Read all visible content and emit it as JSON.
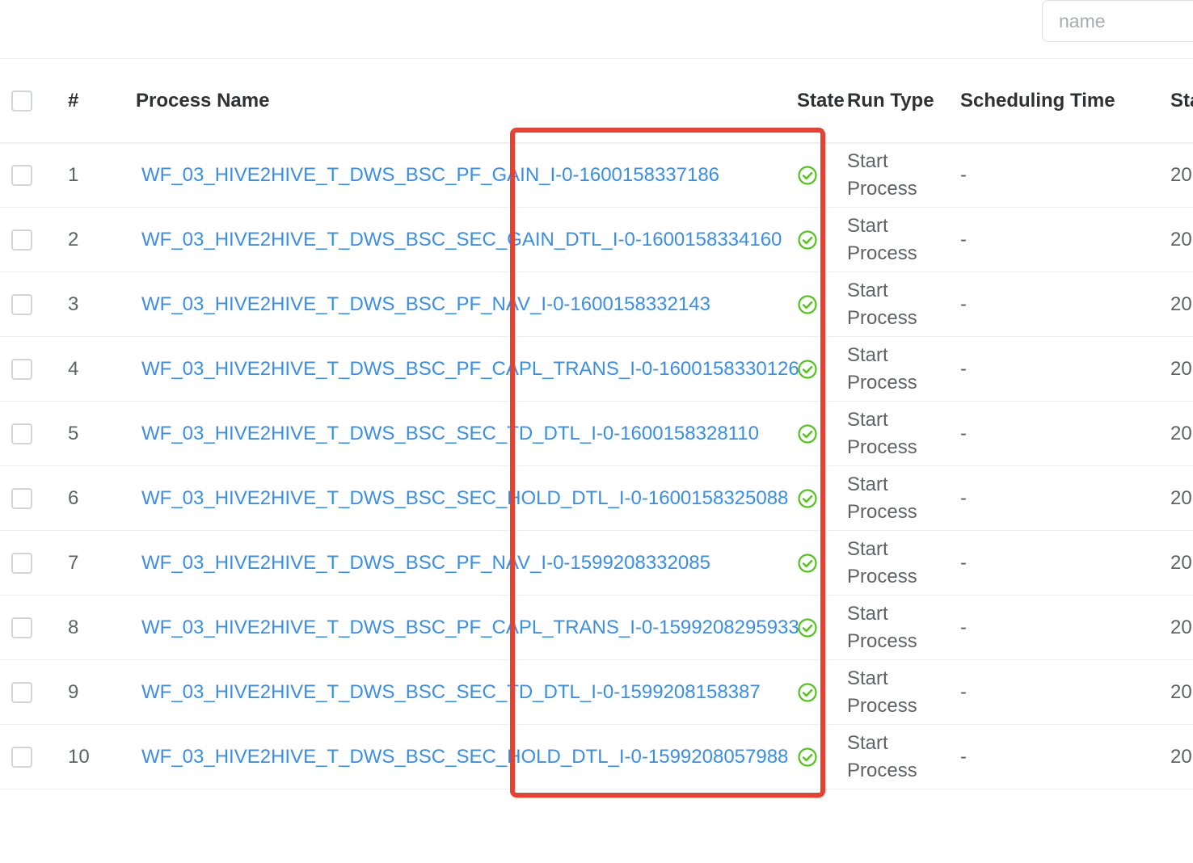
{
  "search": {
    "placeholder": "name"
  },
  "table": {
    "headers": {
      "index": "#",
      "process_name": "Process Name",
      "state": "State",
      "run_type": "Run Type",
      "scheduling_time": "Scheduling Time",
      "start_time": "Sta"
    },
    "rows": [
      {
        "index": "1",
        "name": "WF_03_HIVE2HIVE_T_DWS_BSC_PF_GAIN_I-0-1600158337186",
        "state": "success-check-icon",
        "run_type_line1": "Start",
        "run_type_line2": "Process",
        "scheduling_time": "-",
        "start_time": "20"
      },
      {
        "index": "2",
        "name": "WF_03_HIVE2HIVE_T_DWS_BSC_SEC_GAIN_DTL_I-0-1600158334160",
        "state": "success-check-icon",
        "run_type_line1": "Start",
        "run_type_line2": "Process",
        "scheduling_time": "-",
        "start_time": "20"
      },
      {
        "index": "3",
        "name": "WF_03_HIVE2HIVE_T_DWS_BSC_PF_NAV_I-0-1600158332143",
        "state": "success-check-icon",
        "run_type_line1": "Start",
        "run_type_line2": "Process",
        "scheduling_time": "-",
        "start_time": "20"
      },
      {
        "index": "4",
        "name": "WF_03_HIVE2HIVE_T_DWS_BSC_PF_CAPL_TRANS_I-0-1600158330126",
        "state": "success-check-icon",
        "run_type_line1": "Start",
        "run_type_line2": "Process",
        "scheduling_time": "-",
        "start_time": "20"
      },
      {
        "index": "5",
        "name": "WF_03_HIVE2HIVE_T_DWS_BSC_SEC_TD_DTL_I-0-1600158328110",
        "state": "success-check-icon",
        "run_type_line1": "Start",
        "run_type_line2": "Process",
        "scheduling_time": "-",
        "start_time": "20"
      },
      {
        "index": "6",
        "name": "WF_03_HIVE2HIVE_T_DWS_BSC_SEC_HOLD_DTL_I-0-1600158325088",
        "state": "success-check-icon",
        "run_type_line1": "Start",
        "run_type_line2": "Process",
        "scheduling_time": "-",
        "start_time": "20"
      },
      {
        "index": "7",
        "name": "WF_03_HIVE2HIVE_T_DWS_BSC_PF_NAV_I-0-1599208332085",
        "state": "success-check-icon",
        "run_type_line1": "Start",
        "run_type_line2": "Process",
        "scheduling_time": "-",
        "start_time": "20"
      },
      {
        "index": "8",
        "name": "WF_03_HIVE2HIVE_T_DWS_BSC_PF_CAPL_TRANS_I-0-1599208295933",
        "state": "success-check-icon",
        "run_type_line1": "Start",
        "run_type_line2": "Process",
        "scheduling_time": "-",
        "start_time": "20"
      },
      {
        "index": "9",
        "name": "WF_03_HIVE2HIVE_T_DWS_BSC_SEC_TD_DTL_I-0-1599208158387",
        "state": "success-check-icon",
        "run_type_line1": "Start",
        "run_type_line2": "Process",
        "scheduling_time": "-",
        "start_time": "20"
      },
      {
        "index": "10",
        "name": "WF_03_HIVE2HIVE_T_DWS_BSC_SEC_HOLD_DTL_I-0-1599208057988",
        "state": "success-check-icon",
        "run_type_line1": "Start",
        "run_type_line2": "Process",
        "scheduling_time": "-",
        "start_time": "20"
      }
    ]
  },
  "colors": {
    "link": "#3a8ee6",
    "success": "#52c41a",
    "highlight": "#e84132"
  }
}
